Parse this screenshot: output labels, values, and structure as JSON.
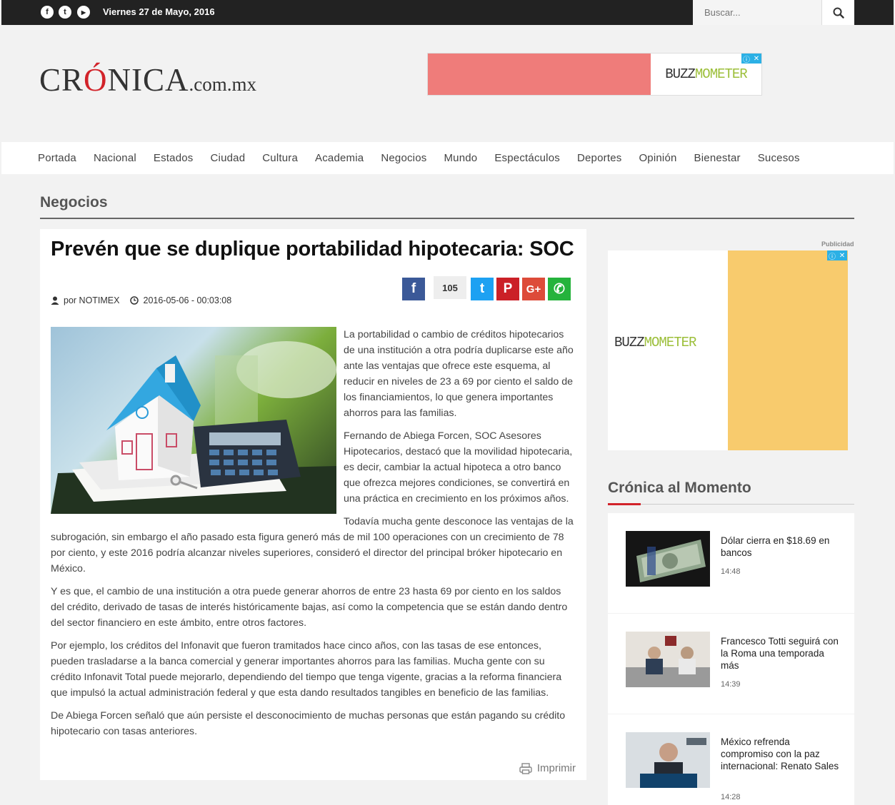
{
  "topbar": {
    "social": [
      {
        "name": "facebook-icon",
        "glyph": "f"
      },
      {
        "name": "twitter-icon",
        "glyph": "t"
      },
      {
        "name": "youtube-icon",
        "glyph": "▶"
      }
    ],
    "date": "Viernes 27 de Mayo, 2016",
    "search_placeholder": "Buscar..."
  },
  "logo": {
    "main": "CRÓNICA",
    "suffix": ".com.mx",
    "accent_color": "#d2232a"
  },
  "ads": {
    "brand_prefix": "BUZZ",
    "brand_suffix": "MOMETER",
    "close_glyph": "✕",
    "info_glyph": "ⓘ",
    "publicidad": "Publicidad"
  },
  "nav": [
    "Portada",
    "Nacional",
    "Estados",
    "Ciudad",
    "Cultura",
    "Academia",
    "Negocios",
    "Mundo",
    "Espectáculos",
    "Deportes",
    "Opinión",
    "Bienestar",
    "Sucesos"
  ],
  "section": "Negocios",
  "article": {
    "headline": "Prevén que se duplique portabilidad hipotecaria: SOC",
    "author": "por NOTIMEX",
    "datetime": "2016-05-06 - 00:03:08",
    "share_count": "105",
    "paragraphs": [
      "La portabilidad o cambio de créditos hipotecarios de una institución a otra podría duplicarse este año ante las ventajas que ofrece este esquema, al reducir en niveles de 23 a 69 por ciento el saldo de los financiamientos, lo que genera importantes ahorros para las familias.",
      "Fernando de Abiega Forcen, SOC Asesores Hipotecarios, destacó que la movilidad hipotecaria, es decir, cambiar la actual hipoteca a otro banco que ofrezca mejores condiciones, se convertirá en una práctica en crecimiento en los próximos años.",
      "Todavía mucha gente desconoce las ventajas de la subrogación, sin embargo el año pasado esta figura generó más de mil 100 operaciones con un crecimiento de 78 por ciento, y este 2016 podría alcanzar niveles superiores, consideró el director del principal bróker hipotecario en México.",
      "Y es que, el cambio de una institución a otra puede generar ahorros de entre 23 hasta 69 por ciento en los saldos del crédito, derivado de tasas de interés históricamente bajas, así como la competencia que se están dando dentro del sector financiero en este ámbito, entre otros factores.",
      "Por ejemplo, los créditos del Infonavit que fueron tramitados hace cinco años, con las tasas de ese entonces, pueden trasladarse a la banca comercial y generar importantes ahorros para las familias. Mucha gente con su crédito Infonavit Total puede mejorarlo, dependiendo del tiempo que tenga vigente, gracias a la reforma financiera que impulsó la actual administración federal y que esta dando resultados tangibles en beneficio de las familias.",
      "De Abiega Forcen señaló que aún persiste el desconocimiento de muchas personas que están pagando su crédito hipotecario con tasas anteriores."
    ],
    "print_label": "Imprimir"
  },
  "share_buttons": [
    {
      "name": "facebook-share-button",
      "glyph": "f",
      "color": "#3b5998"
    },
    {
      "name": "twitter-share-button",
      "glyph": "t",
      "color": "#1da1f2"
    },
    {
      "name": "pinterest-share-button",
      "glyph": "P",
      "color": "#cb2027"
    },
    {
      "name": "googleplus-share-button",
      "glyph": "G+",
      "color": "#dd4b39"
    },
    {
      "name": "whatsapp-share-button",
      "glyph": "✆",
      "color": "#25b33c"
    }
  ],
  "sidebar": {
    "title": "Crónica al Momento",
    "news": [
      {
        "title": "Dólar cierra en $18.69 en bancos",
        "time": "14:48"
      },
      {
        "title": "Francesco Totti seguirá con la Roma una temporada más",
        "time": "14:39"
      },
      {
        "title": "México refrenda compromiso con la paz internacional: Renato Sales",
        "time": "14:28"
      }
    ]
  }
}
